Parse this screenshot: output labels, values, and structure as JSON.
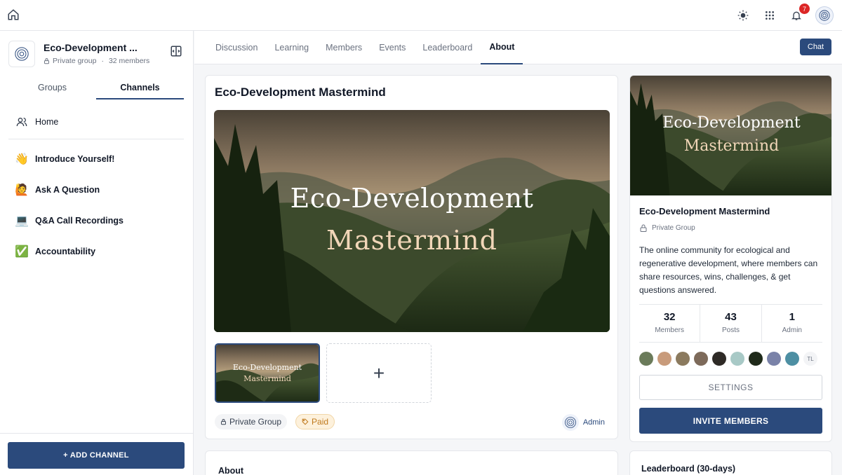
{
  "topbar": {
    "notifications_count": "7"
  },
  "sidebar": {
    "group_name": "Eco-Development ...",
    "privacy": "Private group",
    "separator": "·",
    "members": "32 members",
    "tabs": [
      {
        "label": "Groups"
      },
      {
        "label": "Channels"
      }
    ],
    "home_label": "Home",
    "channels": [
      {
        "label": "Introduce Yourself!",
        "emoji": "👋"
      },
      {
        "label": "Ask A Question",
        "emoji": "🙋"
      },
      {
        "label": "Q&A Call Recordings",
        "emoji": "💻"
      },
      {
        "label": "Accountability",
        "emoji": "✅"
      }
    ],
    "add_channel_label": "+ ADD CHANNEL"
  },
  "main_tabs": [
    {
      "label": "Discussion"
    },
    {
      "label": "Learning"
    },
    {
      "label": "Members"
    },
    {
      "label": "Events"
    },
    {
      "label": "Leaderboard"
    },
    {
      "label": "About"
    }
  ],
  "chat_label": "Chat",
  "main": {
    "title": "Eco-Development Mastermind",
    "hero_line1": "Eco-Development",
    "hero_line2": "Mastermind",
    "add_image_symbol": "+",
    "private_pill": "Private Group",
    "paid_pill": "Paid",
    "admin_label": "Admin"
  },
  "about": {
    "title": "About"
  },
  "right": {
    "hero_line1": "Eco-Development",
    "hero_line2": "Mastermind",
    "name": "Eco-Development Mastermind",
    "privacy": "Private Group",
    "description": "The online community for ecological and regenerative development, where members can share resources, wins, challenges, & get questions answered.",
    "stats": [
      {
        "num": "32",
        "label": "Members"
      },
      {
        "num": "43",
        "label": "Posts"
      },
      {
        "num": "1",
        "label": "Admin"
      }
    ],
    "last_avatar_initials": "TL",
    "settings_label": "SETTINGS",
    "invite_label": "INVITE MEMBERS"
  },
  "leaderboard": {
    "title": "Leaderboard (30-days)"
  },
  "colors": {
    "accent": "#2b4a7c",
    "badge": "#dc2626"
  }
}
